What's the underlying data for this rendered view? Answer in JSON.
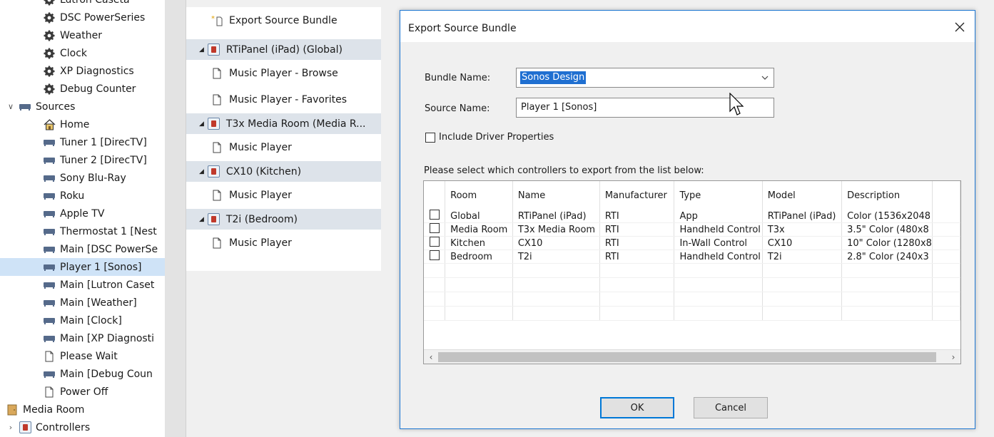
{
  "tree": {
    "items": [
      {
        "label": "Lutron Caseta",
        "icon": "gear-icon",
        "indent": 60
      },
      {
        "label": "DSC PowerSeries",
        "icon": "gear-icon",
        "indent": 60
      },
      {
        "label": "Weather",
        "icon": "gear-icon",
        "indent": 60
      },
      {
        "label": "Clock",
        "icon": "gear-icon",
        "indent": 60
      },
      {
        "label": "XP Diagnostics",
        "icon": "gear-icon",
        "indent": 60
      },
      {
        "label": "Debug Counter",
        "icon": "gear-icon",
        "indent": 60
      },
      {
        "label": "Sources",
        "icon": "source-icon",
        "indent": 8,
        "caret": "down"
      },
      {
        "label": "Home",
        "icon": "home-icon",
        "indent": 60
      },
      {
        "label": "Tuner 1 [DirecTV]",
        "icon": "source-icon",
        "indent": 60
      },
      {
        "label": "Tuner 2 [DirecTV]",
        "icon": "source-icon",
        "indent": 60
      },
      {
        "label": "Sony Blu-Ray",
        "icon": "source-icon",
        "indent": 60
      },
      {
        "label": "Roku",
        "icon": "source-icon",
        "indent": 60
      },
      {
        "label": "Apple TV",
        "icon": "source-icon",
        "indent": 60
      },
      {
        "label": "Thermostat 1 [Nest",
        "icon": "source-icon",
        "indent": 60
      },
      {
        "label": "Main [DSC PowerSe",
        "icon": "source-icon",
        "indent": 60
      },
      {
        "label": "Player 1 [Sonos]",
        "icon": "source-icon",
        "indent": 60,
        "selected": true
      },
      {
        "label": "Main [Lutron Caset",
        "icon": "source-icon",
        "indent": 60
      },
      {
        "label": "Main [Weather]",
        "icon": "source-icon",
        "indent": 60
      },
      {
        "label": "Main [Clock]",
        "icon": "source-icon",
        "indent": 60
      },
      {
        "label": "Main [XP Diagnosti",
        "icon": "source-icon",
        "indent": 60
      },
      {
        "label": "Please Wait",
        "icon": "page-icon",
        "indent": 60
      },
      {
        "label": "Main [Debug Coun",
        "icon": "source-icon",
        "indent": 60
      },
      {
        "label": "Power Off",
        "icon": "page-icon",
        "indent": 60
      },
      {
        "label": "Media Room",
        "icon": "room-icon",
        "indent": 8
      },
      {
        "label": "Controllers",
        "icon": "controller-icon",
        "indent": 8,
        "caret": "right"
      }
    ]
  },
  "mid": {
    "export_label": "Export Source Bundle",
    "groups": [
      {
        "title": "RTiPanel (iPad) (Global)",
        "items": [
          "Music Player - Browse",
          "Music Player - Favorites"
        ]
      },
      {
        "title": "T3x Media Room (Media R...",
        "items": [
          "Music Player"
        ]
      },
      {
        "title": "CX10 (Kitchen)",
        "items": [
          "Music Player"
        ]
      },
      {
        "title": "T2i (Bedroom)",
        "items": [
          "Music Player"
        ]
      }
    ]
  },
  "dialog": {
    "title": "Export Source Bundle",
    "bundle_name_label": "Bundle Name:",
    "bundle_name_value": "Sonos Design",
    "source_name_label": "Source Name:",
    "source_name_value": "Player 1 [Sonos]",
    "include_driver_label": "Include Driver Properties",
    "instruction": "Please select which controllers to export from the list below:",
    "columns": [
      "Room",
      "Name",
      "Manufacturer",
      "Type",
      "Model",
      "Description"
    ],
    "rows": [
      [
        "Global",
        "RTiPanel (iPad)",
        "RTI",
        "App",
        "RTiPanel (iPad)",
        "Color (1536x2048"
      ],
      [
        "Media Room",
        "T3x Media Room",
        "RTI",
        "Handheld Control",
        "T3x",
        "3.5\" Color (480x8"
      ],
      [
        "Kitchen",
        "CX10",
        "RTI",
        "In-Wall Control",
        "CX10",
        "10\" Color (1280x8"
      ],
      [
        "Bedroom",
        "T2i",
        "RTI",
        "Handheld Control",
        "T2i",
        "2.8\" Color (240x3"
      ]
    ],
    "ok_label": "OK",
    "cancel_label": "Cancel"
  },
  "colors": {
    "accent": "#0078d7",
    "selection": "#1f6fd1",
    "header_band": "#dde3ea"
  }
}
